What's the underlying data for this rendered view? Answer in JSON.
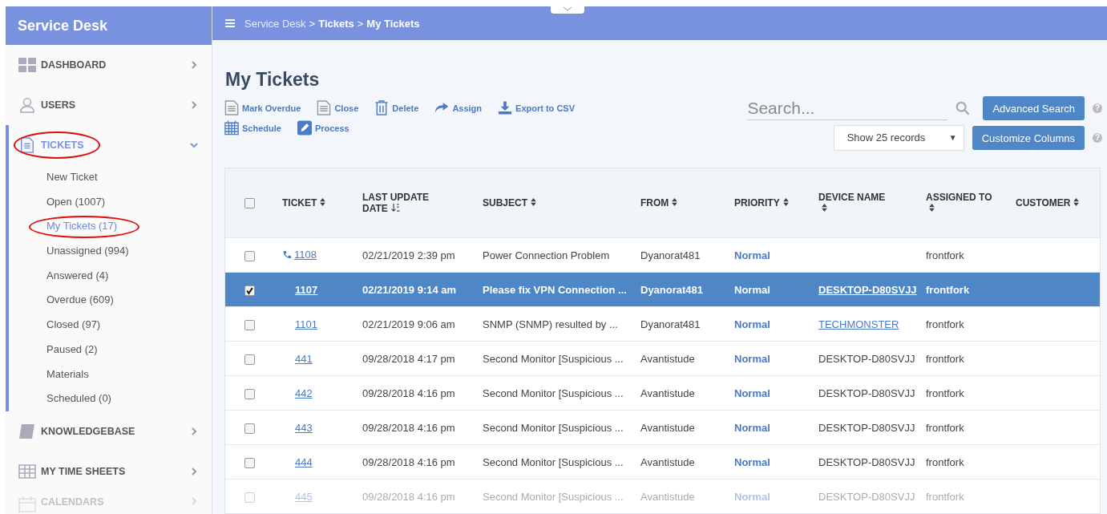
{
  "app": {
    "title": "Service Desk"
  },
  "breadcrumb": {
    "separator": ">",
    "items": [
      "Service Desk",
      "Tickets",
      "My Tickets"
    ]
  },
  "sidebar": {
    "items": [
      {
        "label": "DASHBOARD",
        "kind": "grid",
        "expanded": false,
        "selected": false,
        "circled": false
      },
      {
        "label": "USERS",
        "kind": "user",
        "expanded": false,
        "selected": false,
        "circled": false
      },
      {
        "label": "TICKETS",
        "kind": "document",
        "expanded": true,
        "selected": true,
        "circled": true,
        "children": [
          {
            "label": "New Ticket",
            "selected": false,
            "circled": false
          },
          {
            "label": "Open (1007)",
            "selected": false,
            "circled": false
          },
          {
            "label": "My Tickets (17)",
            "selected": true,
            "circled": true
          },
          {
            "label": "Unassigned (994)",
            "selected": false,
            "circled": false
          },
          {
            "label": "Answered (4)",
            "selected": false,
            "circled": false
          },
          {
            "label": "Overdue (609)",
            "selected": false,
            "circled": false
          },
          {
            "label": "Closed (97)",
            "selected": false,
            "circled": false
          },
          {
            "label": "Paused (2)",
            "selected": false,
            "circled": false
          },
          {
            "label": "Materials",
            "selected": false,
            "circled": false
          },
          {
            "label": "Scheduled (0)",
            "selected": false,
            "circled": false
          }
        ]
      },
      {
        "label": "KNOWLEDGEBASE",
        "kind": "book",
        "expanded": false,
        "selected": false,
        "circled": false
      },
      {
        "label": "MY TIME SHEETS",
        "kind": "table",
        "expanded": false,
        "selected": false,
        "circled": false
      },
      {
        "label": "CALENDARS",
        "kind": "calendar",
        "expanded": false,
        "selected": false,
        "circled": false
      }
    ]
  },
  "page_title": "My Tickets",
  "toolbar_rows": [
    [
      {
        "label": "Mark Overdue",
        "kind": "document"
      },
      {
        "label": "Close",
        "kind": "document"
      },
      {
        "label": "Delete",
        "kind": "trash"
      },
      {
        "label": "Assign",
        "kind": "share"
      },
      {
        "label": "Export to CSV",
        "kind": "download"
      }
    ],
    [
      {
        "label": "Schedule",
        "kind": "calendar"
      },
      {
        "label": "Process",
        "kind": "pencil"
      }
    ]
  ],
  "search": {
    "placeholder": "Search..."
  },
  "advanced_search_button": "Advanced Search",
  "advanced_search_help": "?",
  "records_select": {
    "value": "Show 25 records",
    "caret": "▼"
  },
  "customize_columns_button": "Customize Columns",
  "customize_columns_help": "?",
  "table": {
    "all_checked": false,
    "columns": [
      {
        "label": "TICKET",
        "sorted": false
      },
      {
        "label": "LAST UPDATE DATE",
        "sorted": true
      },
      {
        "label": "SUBJECT",
        "sorted": false
      },
      {
        "label": "FROM",
        "sorted": false
      },
      {
        "label": "PRIORITY",
        "sorted": false
      },
      {
        "label": "DEVICE NAME",
        "sorted": false
      },
      {
        "label": "ASSIGNED TO",
        "sorted": false
      },
      {
        "label": "CUSTOMER",
        "sorted": false
      }
    ],
    "rows": [
      {
        "selected": false,
        "checked": false,
        "faded": false,
        "phone": true,
        "ticket": "1108",
        "date": "02/21/2019 2:39 pm",
        "subject": "Power Connection Problem",
        "from": "Dyanorat481",
        "priority": "Normal",
        "assigned": "frontfork"
      },
      {
        "selected": true,
        "checked": true,
        "faded": false,
        "phone": false,
        "ticket": "1107",
        "date": "02/21/2019 9:14 am",
        "subject": "Please fix VPN Connection ...",
        "from": "Dyanorat481",
        "priority": "Normal",
        "device": "DESKTOP-D80SVJJ",
        "device_link": true,
        "assigned": "frontfork"
      },
      {
        "selected": false,
        "checked": false,
        "faded": false,
        "phone": false,
        "ticket": "1101",
        "date": "02/21/2019 9:06 am",
        "subject": "SNMP (SNMP) resulted by ...",
        "from": "Dyanorat481",
        "priority": "Normal",
        "device": "TECHMONSTER",
        "device_link": true,
        "assigned": "frontfork"
      },
      {
        "selected": false,
        "checked": false,
        "faded": false,
        "phone": false,
        "ticket": "441",
        "date": "09/28/2018 4:17 pm",
        "subject": "Second Monitor [Suspicious ...",
        "from": "Avantistude",
        "priority": "Normal",
        "device": "DESKTOP-D80SVJJ",
        "device_link": false,
        "assigned": "frontfork"
      },
      {
        "selected": false,
        "checked": false,
        "faded": false,
        "phone": false,
        "ticket": "442",
        "date": "09/28/2018 4:16 pm",
        "subject": "Second Monitor [Suspicious ...",
        "from": "Avantistude",
        "priority": "Normal",
        "device": "DESKTOP-D80SVJJ",
        "device_link": false,
        "assigned": "frontfork"
      },
      {
        "selected": false,
        "checked": false,
        "faded": false,
        "phone": false,
        "ticket": "443",
        "date": "09/28/2018 4:16 pm",
        "subject": "Second Monitor [Suspicious ...",
        "from": "Avantistude",
        "priority": "Normal",
        "device": "DESKTOP-D80SVJJ",
        "device_link": false,
        "assigned": "frontfork"
      },
      {
        "selected": false,
        "checked": false,
        "faded": false,
        "phone": false,
        "ticket": "444",
        "date": "09/28/2018 4:16 pm",
        "subject": "Second Monitor [Suspicious ...",
        "from": "Avantistude",
        "priority": "Normal",
        "device": "DESKTOP-D80SVJJ",
        "device_link": false,
        "assigned": "frontfork"
      },
      {
        "selected": false,
        "checked": false,
        "faded": true,
        "phone": false,
        "ticket": "445",
        "date": "09/28/2018 4:16 pm",
        "subject": "Second Monitor [Suspicious ...",
        "from": "Avantistude",
        "priority": "Normal",
        "device": "DESKTOP-D80SVJJ",
        "device_link": false,
        "assigned": "frontfork"
      }
    ]
  }
}
